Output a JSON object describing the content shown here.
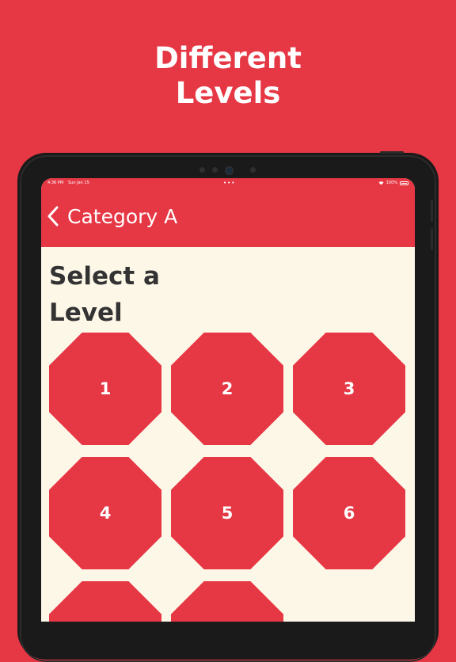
{
  "promo": {
    "title_line1": "Different",
    "title_line2": "Levels"
  },
  "status_bar": {
    "time": "4:36 PM",
    "date": "Sun Jan 15",
    "dots": "•••",
    "battery": "100%"
  },
  "header": {
    "back_icon": "chevron-left-icon",
    "title": "Category A"
  },
  "main": {
    "heading_line1": "Select a",
    "heading_line2": "Level",
    "levels": [
      {
        "number": "1"
      },
      {
        "number": "2"
      },
      {
        "number": "3"
      },
      {
        "number": "4"
      },
      {
        "number": "5"
      },
      {
        "number": "6"
      },
      {
        "number": ""
      },
      {
        "number": ""
      }
    ]
  },
  "colors": {
    "brand_red": "#e63744",
    "screen_background": "#fdf7e7",
    "heading_text": "#333333",
    "device_frame": "#1a1a1a"
  }
}
